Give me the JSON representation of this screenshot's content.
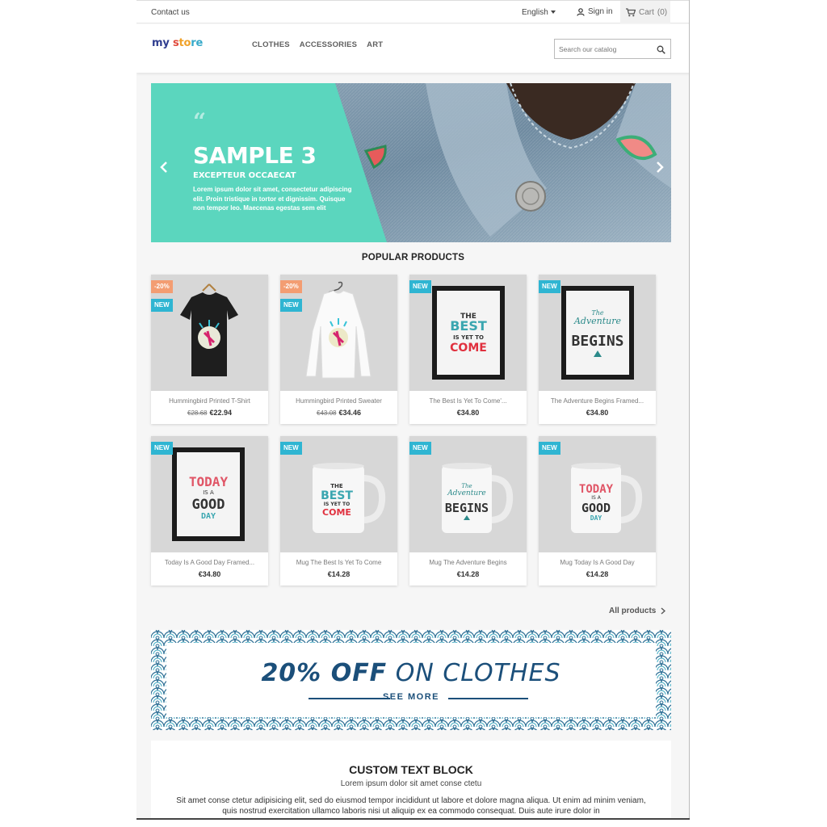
{
  "topbar": {
    "contact": "Contact us",
    "language": "English",
    "signin": "Sign in",
    "cart": "Cart",
    "cart_count": "(0)"
  },
  "header": {
    "logo_parts": [
      "my",
      " s",
      "to",
      "re"
    ],
    "menu": [
      "CLOTHES",
      "ACCESSORIES",
      "ART"
    ],
    "search_placeholder": "Search our catalog"
  },
  "hero": {
    "quote_mark": "“",
    "title": "SAMPLE 3",
    "subtitle": "EXCEPTEUR OCCAECAT",
    "description": "Lorem ipsum dolor sit amet, consectetur adipiscing elit. Proin tristique in tortor et dignissim. Quisque non tempor leo. Maecenas egestas sem elit",
    "accent_color": "#5bd6be"
  },
  "popular": {
    "title": "POPULAR PRODUCTS",
    "products": [
      {
        "name": "Hummingbird Printed T-Shirt",
        "old_price": "€28.68",
        "price": "€22.94",
        "discount": "-20%",
        "flag": "NEW",
        "image": "tshirt-black"
      },
      {
        "name": "Hummingbird Printed Sweater",
        "old_price": "€43.08",
        "price": "€34.46",
        "discount": "-20%",
        "flag": "NEW",
        "image": "sweater-white"
      },
      {
        "name": "The Best Is Yet To Come'...",
        "old_price": "",
        "price": "€34.80",
        "discount": "",
        "flag": "NEW",
        "image": "frame-best"
      },
      {
        "name": "The Adventure Begins Framed...",
        "old_price": "",
        "price": "€34.80",
        "discount": "",
        "flag": "NEW",
        "image": "frame-adventure"
      },
      {
        "name": "Today Is A Good Day Framed...",
        "old_price": "",
        "price": "€34.80",
        "discount": "",
        "flag": "NEW",
        "image": "frame-today"
      },
      {
        "name": "Mug The Best Is Yet To Come",
        "old_price": "",
        "price": "€14.28",
        "discount": "",
        "flag": "NEW",
        "image": "mug-best"
      },
      {
        "name": "Mug The Adventure Begins",
        "old_price": "",
        "price": "€14.28",
        "discount": "",
        "flag": "NEW",
        "image": "mug-adventure"
      },
      {
        "name": "Mug Today Is A Good Day",
        "old_price": "",
        "price": "€14.28",
        "discount": "",
        "flag": "NEW",
        "image": "mug-today"
      }
    ],
    "all_products": "All products"
  },
  "promo": {
    "bold": "20% OFF",
    "rest": " ON CLOTHES",
    "see_more": "SEE MORE"
  },
  "custom_block": {
    "title": "CUSTOM TEXT BLOCK",
    "subtitle": "Lorem ipsum dolor sit amet conse ctetu",
    "body": "Sit amet conse ctetur adipisicing elit, sed do eiusmod tempor incididunt ut labore et dolore magna aliqua. Ut enim ad minim veniam, quis nostrud exercitation ullamco laboris nisi ut aliquip ex ea commodo consequat. Duis aute irure dolor in"
  },
  "art": {
    "best": [
      "THE",
      "BEST",
      "IS YET",
      "TO",
      "COME"
    ],
    "adventure": [
      "The",
      "Adventure",
      "BEGINS"
    ],
    "today": [
      "TODAY",
      "IS A",
      "GOOD",
      "DAY"
    ]
  }
}
